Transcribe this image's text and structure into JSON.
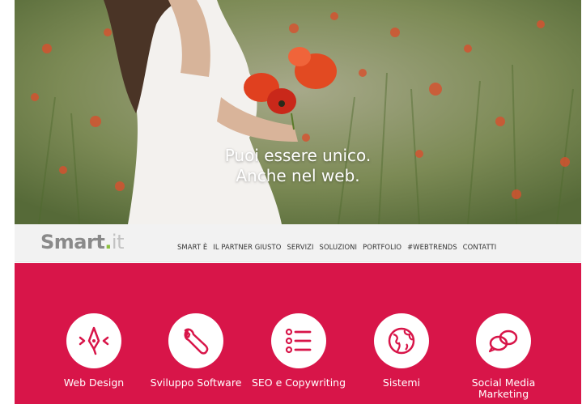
{
  "hero": {
    "line1": "Puoi essere unico.",
    "line2": "Anche nel web."
  },
  "header": {
    "logo": {
      "name": "Smart",
      "dot": ".",
      "tld": "it"
    },
    "nav": [
      "SMART È",
      "IL PARTNER GIUSTO",
      "SERVIZI",
      "SOLUZIONI",
      "PORTFOLIO",
      "#WEBTRENDS",
      "CONTATTI"
    ]
  },
  "services": {
    "background": "#d81549",
    "items": [
      {
        "label": "Web Design",
        "icon": "pen-nib-icon"
      },
      {
        "label": "Sviluppo Software",
        "icon": "wrench-icon"
      },
      {
        "label": "SEO e Copywriting",
        "icon": "list-icon"
      },
      {
        "label": "Sistemi",
        "icon": "globe-icon"
      },
      {
        "label": "Social Media Marketing",
        "icon": "speech-bubbles-icon"
      }
    ]
  },
  "colors": {
    "accent": "#d81549",
    "logo_dot": "#8bbf3f"
  }
}
